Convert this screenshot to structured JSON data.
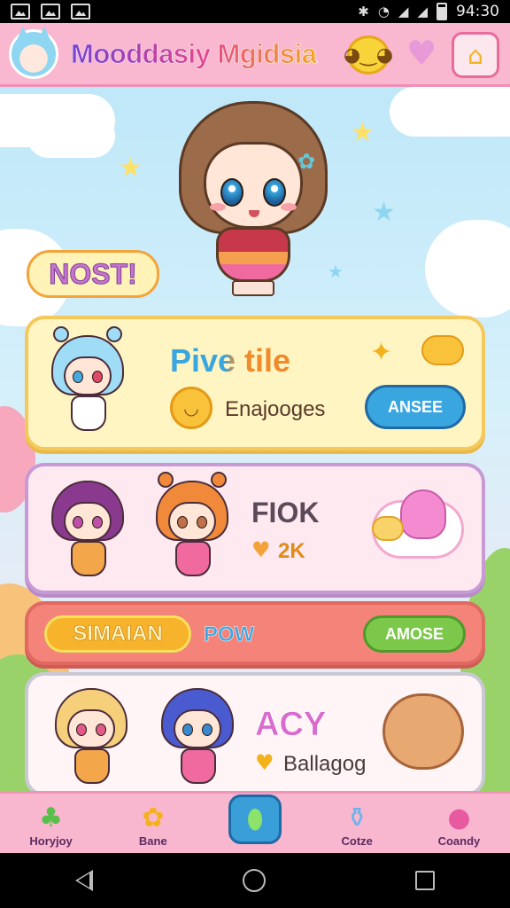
{
  "status_bar": {
    "time": "94:30"
  },
  "header": {
    "title": "Mooddasiy Mgidsia"
  },
  "banner": {
    "label": "NOST!"
  },
  "cards": [
    {
      "title": "Pive tile",
      "subtitle": "Enajooges",
      "button": "ANSEE"
    },
    {
      "title": "FIOK",
      "subtitle": "2K"
    },
    {
      "pill": "SIMAIAN",
      "title": "POW",
      "button": "AMOSE"
    },
    {
      "title": "ACY",
      "subtitle": "Ballagog"
    }
  ],
  "nav": [
    {
      "label": "Horyjoy"
    },
    {
      "label": "Bane"
    },
    {
      "label": ""
    },
    {
      "label": "Cotze"
    },
    {
      "label": "Coandy"
    }
  ],
  "colors": {
    "header_bg": "#f9b7d0",
    "accent_pink": "#e7468e",
    "blue_button": "#3aa6e0",
    "green_button": "#7cc84a",
    "orange_pill": "#f7b32b"
  }
}
